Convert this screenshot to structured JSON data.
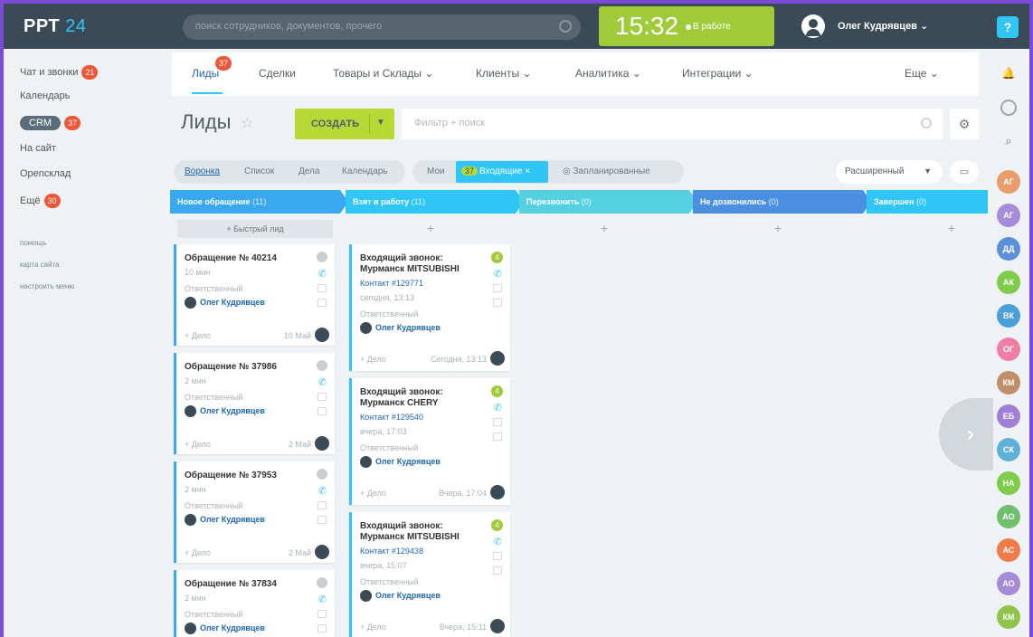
{
  "app": {
    "logo_main": "РРТ",
    "logo_num": "24"
  },
  "search": {
    "placeholder": "поиск сотрудников, документов, прочего"
  },
  "clock": {
    "time": "15:32",
    "status": "В работе"
  },
  "user": {
    "name": "Олег Кудрявцев"
  },
  "help": "?",
  "left_menu": {
    "chat": "Чат и звонки",
    "chat_badge": "21",
    "calendar": "Календарь",
    "crm": "CRM",
    "crm_badge": "37",
    "site": "На сайт",
    "warehouse": "Openсклад",
    "more": "Ещё",
    "more_badge": "30",
    "help": "помощь",
    "sitemap": "карта сайта",
    "configure": "настроить меню"
  },
  "tabs": {
    "leads": "Лиды",
    "leads_badge": "37",
    "deals": "Сделки",
    "goods": "Товары и Склады ⌄",
    "clients": "Клиенты ⌄",
    "analytics": "Аналитика ⌄",
    "integrations": "Интеграции ⌄",
    "more": "Еще ⌄"
  },
  "toolbar": {
    "title": "Лиды",
    "create": "СОЗДАТЬ",
    "filter_placeholder": "Фильтр + поиск"
  },
  "views": {
    "funnel": "Воронка",
    "list": "Список",
    "deals": "Дела",
    "calendar": "Календарь"
  },
  "filters": {
    "my": "Мои",
    "incoming_count": "37",
    "incoming": "Входящие",
    "planned": "Запланированные"
  },
  "extended": "Расширенный",
  "quick_add": "+ Быстрый лид",
  "stages": [
    {
      "name": "Новое обращение",
      "count": "(11)",
      "color": "#39a8ef"
    },
    {
      "name": "Взят в работу",
      "count": "(11)",
      "color": "#2fc6f6"
    },
    {
      "name": "Перезвонить",
      "count": "(0)",
      "color": "#55d0e0"
    },
    {
      "name": "Не дозвонились",
      "count": "(0)",
      "color": "#4b8fe0"
    },
    {
      "name": "Завершен",
      "count": "(0)",
      "color": "#2fc6f6"
    }
  ],
  "col1_cards": [
    {
      "title": "Обращение № 40214",
      "ago": "10 мин",
      "status": "Ответственный",
      "owner": "Олег Кудрявцев",
      "act": "+ Дело",
      "date": "10 Май"
    },
    {
      "title": "Обращение № 37986",
      "ago": "2 мин",
      "status": "Ответственный",
      "owner": "Олег Кудрявцев",
      "act": "+ Дело",
      "date": "2 Май"
    },
    {
      "title": "Обращение № 37953",
      "ago": "2 мин",
      "status": "Ответственный",
      "owner": "Олег Кудрявцев",
      "act": "+ Дело",
      "date": "2 Май"
    },
    {
      "title": "Обращение № 37834",
      "ago": "2 мин",
      "status": "Ответственный",
      "owner": "Олег Кудрявцев"
    }
  ],
  "col2_cards": [
    {
      "title": "Входящий звонок: Мурманск MITSUBISHI",
      "contact": "Контакт #129771",
      "time": "сегодня, 13:13",
      "status": "Ответственный",
      "owner": "Олег Кудрявцев",
      "act": "+ Дело",
      "date": "Сегодня, 13:13",
      "num": "4"
    },
    {
      "title": "Входящий звонок: Мурманск CHERY",
      "contact": "Контакт #129540",
      "time": "вчера, 17:03",
      "status": "Ответственный",
      "owner": "Олег Кудрявцев",
      "act": "+ Дело",
      "date": "Вчера, 17:04",
      "num": "4"
    },
    {
      "title": "Входящий звонок: Мурманск MITSUBISHI",
      "contact": "Контакт #129438",
      "time": "вчера, 15:07",
      "status": "Ответственный",
      "owner": "Олег Кудрявцев",
      "act": "+ Дело",
      "date": "Вчера, 15:11",
      "num": "4"
    }
  ],
  "right_avatars": [
    {
      "initials": "АГ",
      "color": "#e89b6b"
    },
    {
      "initials": "АГ",
      "color": "#a58bd8"
    },
    {
      "initials": "ДД",
      "color": "#5b8fd8"
    },
    {
      "initials": "АК",
      "color": "#7fcb4a"
    },
    {
      "initials": "ВК",
      "color": "#4a9fd8"
    },
    {
      "initials": "ОГ",
      "color": "#ee7fa3"
    },
    {
      "initials": "КМ",
      "color": "#c08f6a"
    },
    {
      "initials": "ЕБ",
      "color": "#9f7fd8"
    },
    {
      "initials": "СК",
      "color": "#5fb0d8"
    },
    {
      "initials": "НА",
      "color": "#7fcb4a"
    },
    {
      "initials": "АО",
      "color": "#6fbf6f"
    },
    {
      "initials": "АС",
      "color": "#f07a4a"
    },
    {
      "initials": "АО",
      "color": "#a58bd8"
    },
    {
      "initials": "КМ",
      "color": "#8fc34a"
    }
  ]
}
